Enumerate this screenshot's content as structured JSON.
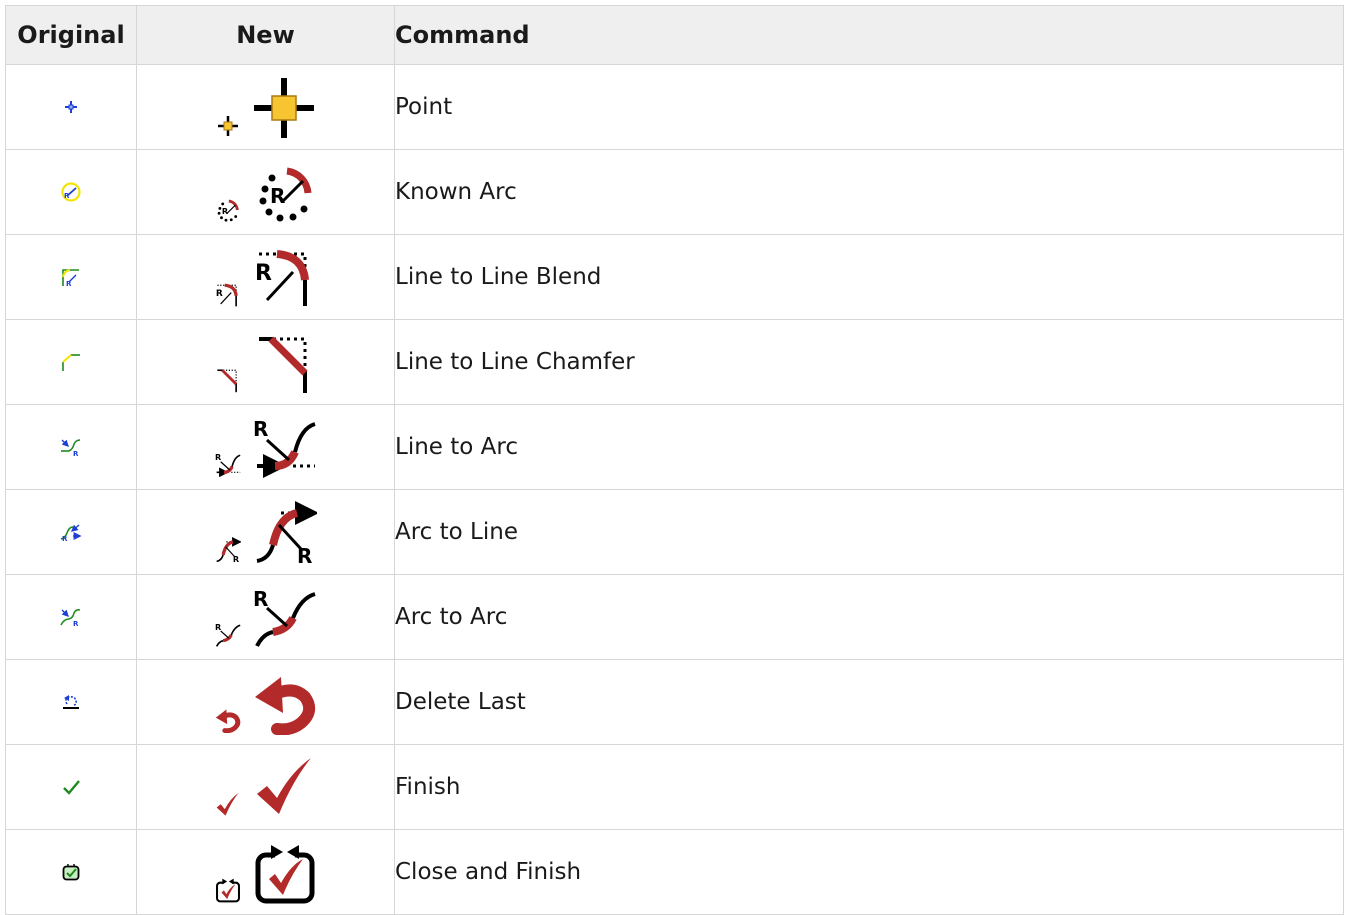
{
  "table": {
    "headers": {
      "original": "Original",
      "new": "New",
      "command": "Command"
    },
    "rows": [
      {
        "icon": "point-icon",
        "command": "Point"
      },
      {
        "icon": "known-arc-icon",
        "command": "Known Arc"
      },
      {
        "icon": "line-to-line-blend-icon",
        "command": "Line to Line Blend"
      },
      {
        "icon": "line-to-line-chamfer-icon",
        "command": "Line to Line Chamfer"
      },
      {
        "icon": "line-to-arc-icon",
        "command": "Line to Arc"
      },
      {
        "icon": "arc-to-line-icon",
        "command": "Arc to Line"
      },
      {
        "icon": "arc-to-arc-icon",
        "command": "Arc to Arc"
      },
      {
        "icon": "delete-last-icon",
        "command": "Delete Last"
      },
      {
        "icon": "finish-icon",
        "command": "Finish"
      },
      {
        "icon": "close-and-finish-icon",
        "command": "Close and Finish"
      }
    ]
  },
  "icon_letters": {
    "radius": "R"
  },
  "colors": {
    "new_icon_red": "#b22a2a",
    "new_icon_black": "#000000",
    "point_yellow": "#f7c531",
    "original_blue": "#1d3fd6",
    "original_green": "#1f8a1f",
    "original_yellow": "#f2e600",
    "header_bg": "#efefef",
    "border": "#d6d6d6"
  }
}
